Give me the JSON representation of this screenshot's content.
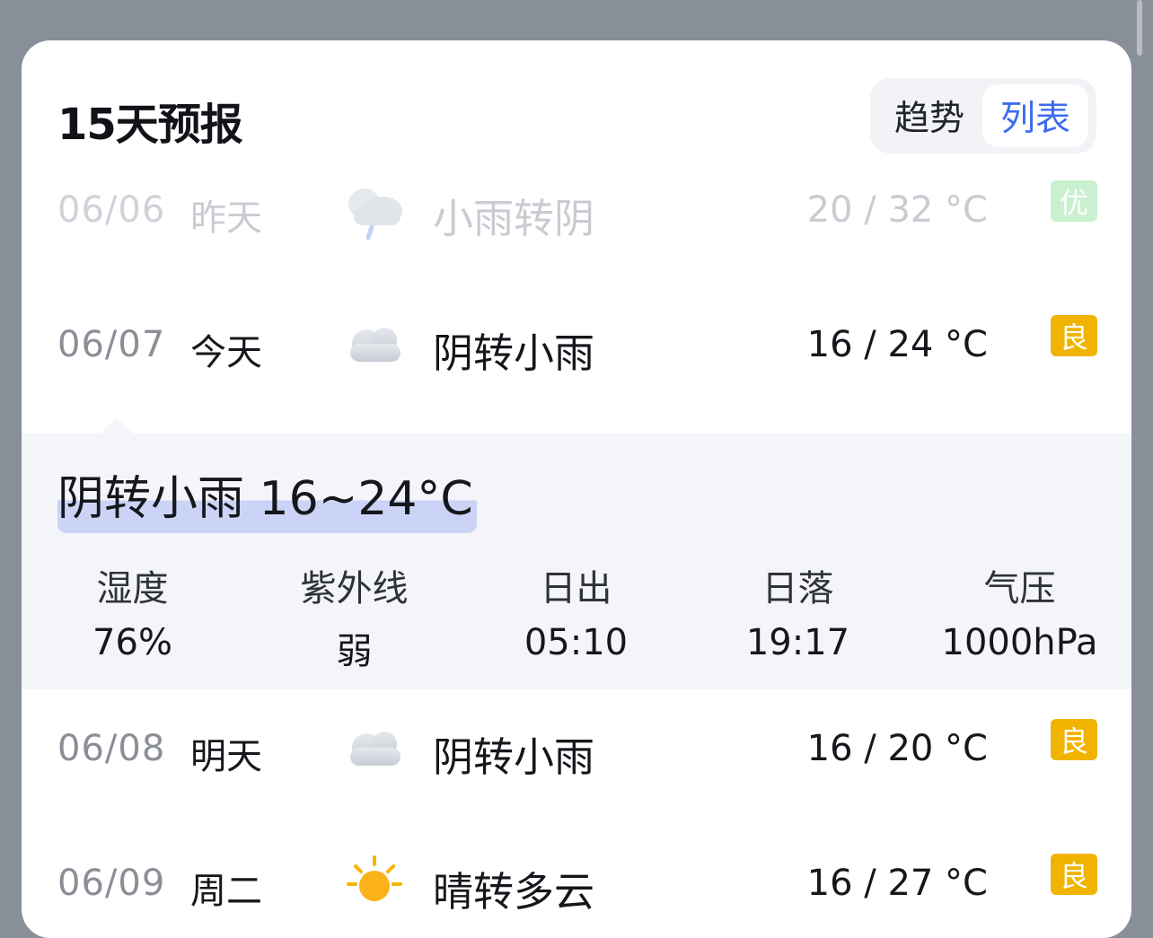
{
  "header": {
    "title": "15天预报",
    "toggle": {
      "trend": "趋势",
      "list": "列表",
      "active": "list"
    }
  },
  "days": [
    {
      "date": "06/06",
      "day": "昨天",
      "icon": "rain-cloud-icon",
      "condition": "小雨转阴",
      "temp": "20 / 32 °C",
      "aqi": "优",
      "aqi_color": "#4cd264",
      "faded": true
    },
    {
      "date": "06/07",
      "day": "今天",
      "icon": "cloud-icon",
      "condition": "阴转小雨",
      "temp": "16 / 24 °C",
      "aqi": "良",
      "aqi_color": "#f0b400",
      "faded": false
    },
    {
      "date": "06/08",
      "day": "明天",
      "icon": "cloud-icon",
      "condition": "阴转小雨",
      "temp": "16 / 20 °C",
      "aqi": "良",
      "aqi_color": "#f0b400",
      "faded": false
    },
    {
      "date": "06/09",
      "day": "周二",
      "icon": "sun-icon",
      "condition": "晴转多云",
      "temp": "16 / 27 °C",
      "aqi": "良",
      "aqi_color": "#f0b400",
      "faded": false
    }
  ],
  "detail": {
    "summary": "阴转小雨 16~24°C",
    "metrics": [
      {
        "label": "湿度",
        "value": "76%"
      },
      {
        "label": "紫外线",
        "value": "弱"
      },
      {
        "label": "日出",
        "value": "05:10"
      },
      {
        "label": "日落",
        "value": "19:17"
      },
      {
        "label": "气压",
        "value": "1000hPa"
      }
    ]
  }
}
